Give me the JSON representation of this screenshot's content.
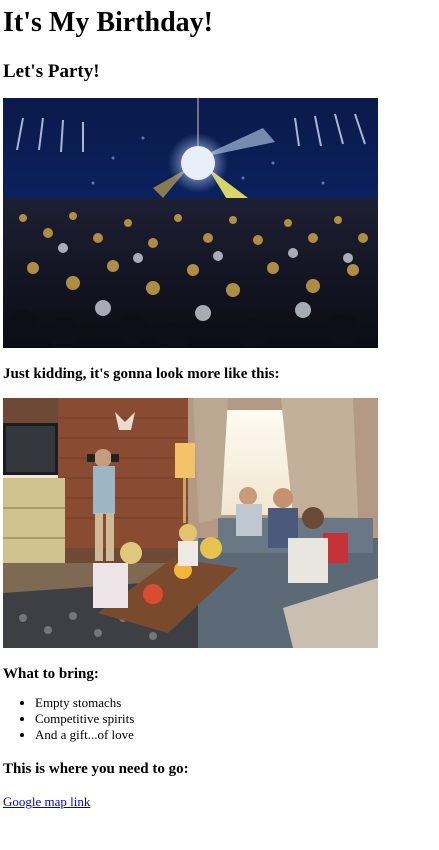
{
  "page": {
    "title": "It's My Birthday!",
    "subtitle": "Let's Party!",
    "kidding_text": "Just kidding, it's gonna look more like this:",
    "bring_heading": "What to bring:",
    "bring_items": [
      "Empty stomachs",
      "Competitive spirits",
      "And a gift...of love"
    ],
    "where_heading": "This is where you need to go:",
    "map_link_text": "Google map link"
  },
  "images": {
    "party": "photo of a crowded concert with a disco ball and stage lights",
    "living_room": "photo of friends relaxing on a couch in a living room"
  },
  "colors": {
    "link": "#0000ee",
    "text": "#000000",
    "background": "#ffffff"
  }
}
